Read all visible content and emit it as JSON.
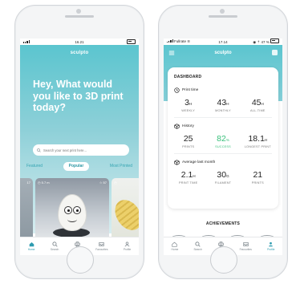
{
  "left_phone": {
    "status": {
      "time": "16.21"
    },
    "logo": "sculpto",
    "headline": "Hey, What would you like to 3D print today?",
    "search_placeholder": "Search your next print here...",
    "tabs": [
      {
        "label": "Featured",
        "active": false
      },
      {
        "label": "Popular",
        "active": true
      },
      {
        "label": "Most Printed",
        "active": false
      }
    ],
    "cards": [
      {
        "likes": "17"
      },
      {
        "time": "5.7 m",
        "likes": "57"
      },
      {
        "likes": ""
      }
    ],
    "nav": [
      {
        "label": "Home",
        "icon": "home-icon",
        "active": true
      },
      {
        "label": "Search",
        "icon": "search-icon",
        "active": false
      },
      {
        "label": "Print",
        "icon": "printer-icon",
        "active": false
      },
      {
        "label": "Favourites",
        "icon": "inbox-icon",
        "active": false
      },
      {
        "label": "Profile",
        "icon": "user-icon",
        "active": false
      }
    ]
  },
  "right_phone": {
    "status": {
      "carrier": "Fullrate",
      "time": "17.14",
      "battery": "47 %"
    },
    "logo": "sculpto",
    "dashboard": {
      "title": "DASHBOARD",
      "print_time": {
        "title": "Print time",
        "stats": [
          {
            "value": "3",
            "unit": "H",
            "label": "WEEKLY"
          },
          {
            "value": "43",
            "unit": "H",
            "label": "MONTHLY"
          },
          {
            "value": "45",
            "unit": "H",
            "label": "ALL-TIME"
          }
        ]
      },
      "history": {
        "title": "History",
        "stats": [
          {
            "value": "25",
            "unit": "",
            "label": "PRINTS"
          },
          {
            "value": "82",
            "unit": "%",
            "label": "SUCCESS"
          },
          {
            "value": "18.1",
            "unit": "H",
            "label": "LONGEST PRINT"
          }
        ]
      },
      "average": {
        "title": "Average last month",
        "stats": [
          {
            "value": "2.1",
            "unit": "H",
            "label": "PRINT TIME"
          },
          {
            "value": "30",
            "unit": "G",
            "label": "FILAMENT"
          },
          {
            "value": "21",
            "unit": "",
            "label": "PRINTS"
          }
        ]
      }
    },
    "achievements_title": "ACHIEVEMENTS",
    "nav": [
      {
        "label": "Home",
        "icon": "home-icon",
        "active": false
      },
      {
        "label": "Search",
        "icon": "search-icon",
        "active": false
      },
      {
        "label": "Prints",
        "icon": "printer-icon",
        "active": false
      },
      {
        "label": "Favourites",
        "icon": "inbox-icon",
        "active": false
      },
      {
        "label": "Profile",
        "icon": "user-icon",
        "active": true
      }
    ]
  },
  "colors": {
    "brand": "#5bc5cf",
    "success": "#39c07b",
    "nav_active": "#2f9cb0"
  }
}
